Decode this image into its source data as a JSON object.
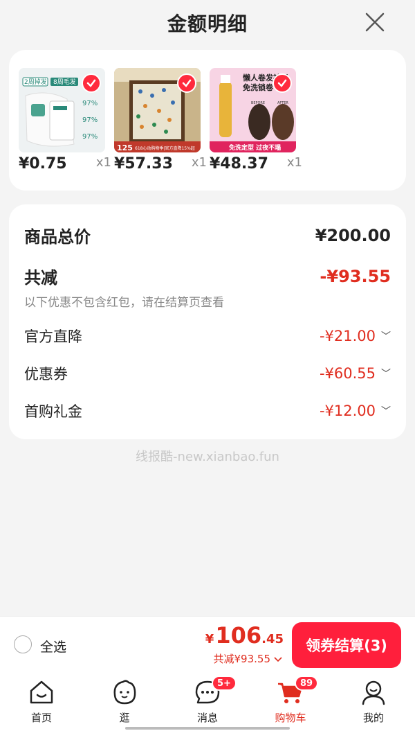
{
  "header": {
    "title": "金额明细",
    "close_icon": "close-icon"
  },
  "products": [
    {
      "price": "¥0.75",
      "qty": "x1",
      "thumb_texts": [
        "2周掉发",
        "8周毛发",
        "97%",
        "97%",
        "97%"
      ],
      "colors": {
        "bg": "#e9eef0",
        "accent": "#2a8a7a"
      }
    },
    {
      "price": "¥57.33",
      "qty": "x1",
      "thumb_texts": [
        "125",
        "618心动购物季|官方直降15%起"
      ],
      "colors": {
        "bg": "#d8c8a8",
        "accent": "#c0392b"
      }
    },
    {
      "price": "¥48.37",
      "qty": "x1",
      "thumb_texts": [
        "懒人卷发神器",
        "免洗锁卷",
        "BEFORE",
        "AFTER",
        "免洗定型 过夜不塌"
      ],
      "colors": {
        "bg": "#f3c9dd",
        "accent": "#e0245e"
      }
    }
  ],
  "summary": {
    "subtotal_label": "商品总价",
    "subtotal_value": "¥200.00",
    "reduction_label": "共减",
    "reduction_value": "-¥93.55",
    "note": "以下优惠不包含红包，请在结算页查看",
    "items": [
      {
        "label": "官方直降",
        "value": "-¥21.00"
      },
      {
        "label": "优惠券",
        "value": "-¥60.55"
      },
      {
        "label": "首购礼金",
        "value": "-¥12.00"
      }
    ]
  },
  "watermark": "线报酷-new.xianbao.fun",
  "checkout": {
    "select_all": "全选",
    "currency": "¥",
    "total_int": "106",
    "total_dec": ".45",
    "reduced": "共减¥93.55",
    "button": "领券结算(3)"
  },
  "tabbar": [
    {
      "label": "首页",
      "icon": "home-icon",
      "badge": ""
    },
    {
      "label": "逛",
      "icon": "face-icon",
      "badge": ""
    },
    {
      "label": "消息",
      "icon": "message-icon",
      "badge": "5+"
    },
    {
      "label": "购物车",
      "icon": "cart-icon",
      "badge": "89",
      "active": true
    },
    {
      "label": "我的",
      "icon": "person-icon",
      "badge": ""
    }
  ],
  "colors": {
    "accent": "#e02d1f",
    "button": "#ff1f3c",
    "background": "#f4f4f4"
  }
}
